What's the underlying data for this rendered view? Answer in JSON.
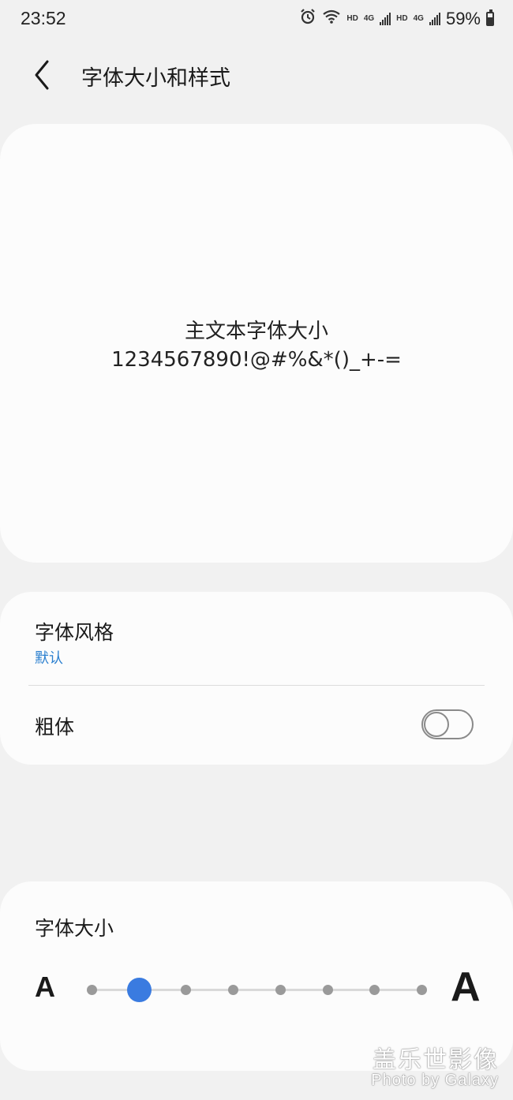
{
  "status_bar": {
    "time": "23:52",
    "hd1": "HD",
    "net1": "4G",
    "hd2": "HD",
    "net2": "4G",
    "battery": "59%"
  },
  "header": {
    "title": "字体大小和样式",
    "back_icon": "chevron-left-icon"
  },
  "preview": {
    "line1": "主文本字体大小",
    "line2": "1234567890!@#%&*()_+-="
  },
  "options": {
    "font_style": {
      "title": "字体风格",
      "value": "默认",
      "value_color": "#2a7fcf"
    },
    "bold": {
      "title": "粗体",
      "enabled": false
    }
  },
  "font_size": {
    "title": "字体大小",
    "small_label": "A",
    "large_label": "A",
    "steps": 8,
    "selected_index": 1,
    "accent_color": "#3a7be0"
  },
  "watermark": {
    "line1": "盖乐世影像",
    "line2": "Photo by Galaxy"
  }
}
